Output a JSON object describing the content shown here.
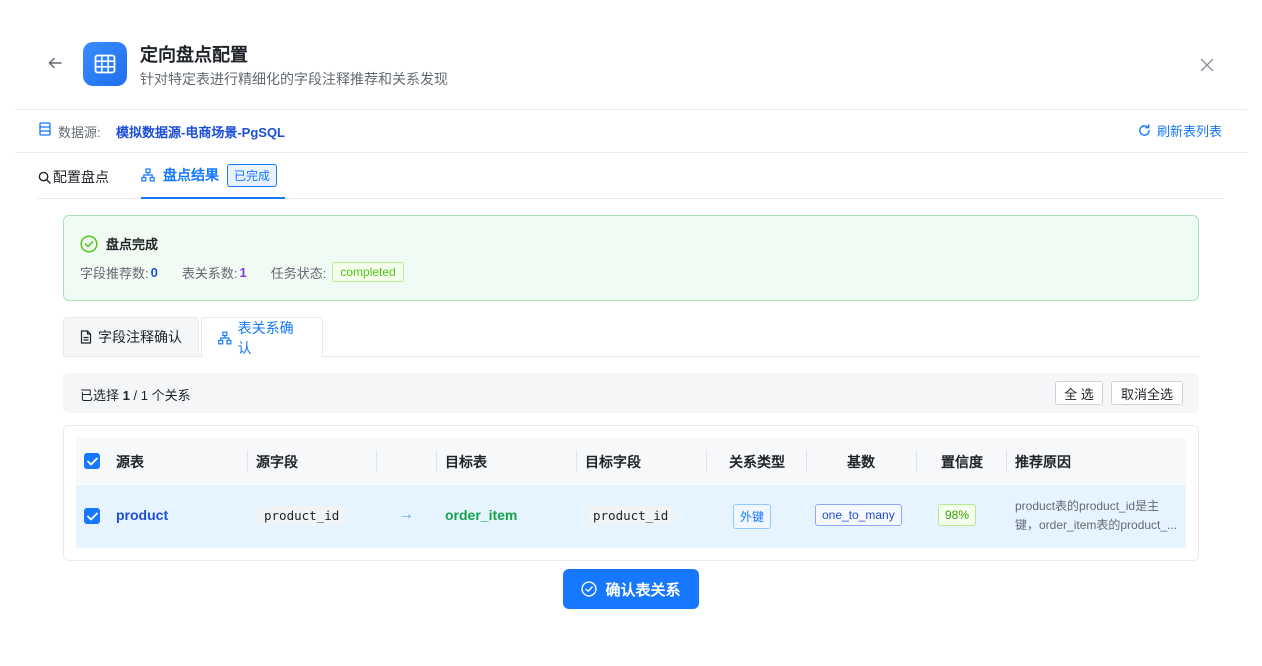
{
  "header": {
    "title": "定向盘点配置",
    "subtitle": "针对特定表进行精细化的字段注释推荐和关系发现"
  },
  "datasource": {
    "label": "数据源:",
    "value": "模拟数据源-电商场景-PgSQL",
    "refresh_label": "刷新表列表"
  },
  "tabs": {
    "config_label": "配置盘点",
    "result_label": "盘点结果",
    "result_badge": "已完成"
  },
  "result": {
    "title": "盘点完成",
    "field_rec_label": "字段推荐数:",
    "field_rec_count": "0",
    "relation_label": "表关系数:",
    "relation_count": "1",
    "task_status_label": "任务状态:",
    "task_status": "completed"
  },
  "sub_tabs": {
    "field_confirm": "字段注释确认",
    "relation_confirm": "表关系确认"
  },
  "selection": {
    "prefix": "已选择",
    "selected": "1",
    "suffix": "/ 1 个关系",
    "select_all": "全 选",
    "deselect_all": "取消全选"
  },
  "table": {
    "columns": [
      "源表",
      "源字段",
      "目标表",
      "目标字段",
      "关系类型",
      "基数",
      "置信度",
      "推荐原因"
    ],
    "rows": [
      {
        "source_table": "product",
        "source_field": "product_id",
        "arrow": "→",
        "target_table": "order_item",
        "target_field": "product_id",
        "relation_type": "外键",
        "cardinality": "one_to_many",
        "confidence": "98%",
        "reason_line1": "product表的product_id是主",
        "reason_line2": "键，order_item表的product_..."
      }
    ]
  },
  "confirm_button": "确认表关系",
  "colors": {
    "primary": "#1677ff",
    "success_bg": "#f0fbf3",
    "source_table": "#1d4ed8",
    "target_table": "#16a34a"
  },
  "icons": [
    "back-arrow-icon",
    "table-grid-icon",
    "close-icon",
    "database-icon",
    "refresh-icon",
    "search-icon",
    "hierarchy-icon",
    "check-circle-icon",
    "document-icon",
    "checkbox-checked-icon"
  ]
}
